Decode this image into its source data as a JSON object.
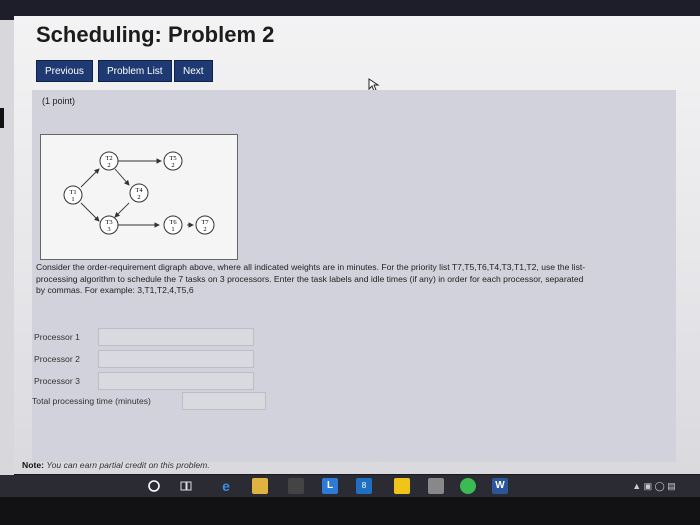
{
  "page": {
    "title": "Scheduling: Problem 2",
    "nav": {
      "previous": "Previous",
      "problem_list": "Problem List",
      "next": "Next"
    }
  },
  "problem": {
    "points": "(1 point)",
    "graph": {
      "nodes": [
        {
          "id": "T1",
          "weight": "1"
        },
        {
          "id": "T2",
          "weight": "2"
        },
        {
          "id": "T3",
          "weight": "3"
        },
        {
          "id": "T4",
          "weight": "2"
        },
        {
          "id": "T5",
          "weight": "2"
        },
        {
          "id": "T6",
          "weight": "1"
        },
        {
          "id": "T7",
          "weight": "2"
        }
      ]
    },
    "text_line1": "Consider the order-requirement digraph above, where all indicated weights are in minutes. For the priority list T7,T5,T6,T4,T3,T1,T2, use the list-",
    "text_line2": "processing algorithm to schedule the 7 tasks on 3 processors. Enter the task labels and idle times (if any) in order for each processor, separated",
    "text_line3": "by commas. For example: 3,T1,T2,4,T5,6",
    "processor1_label": "Processor 1",
    "processor2_label": "Processor 2",
    "processor3_label": "Processor 3",
    "processor1_value": "",
    "processor2_value": "",
    "processor3_value": "",
    "total_label": "Total processing time (minutes)",
    "total_value": ""
  },
  "note": {
    "label": "Note:",
    "text": "You can earn partial credit on this problem."
  },
  "taskbar": {
    "store_badge": "8"
  },
  "colors": {
    "nav_button": "#1f3a73",
    "problem_bg": "#d2d2dc",
    "taskbar": "#2b2b33"
  }
}
